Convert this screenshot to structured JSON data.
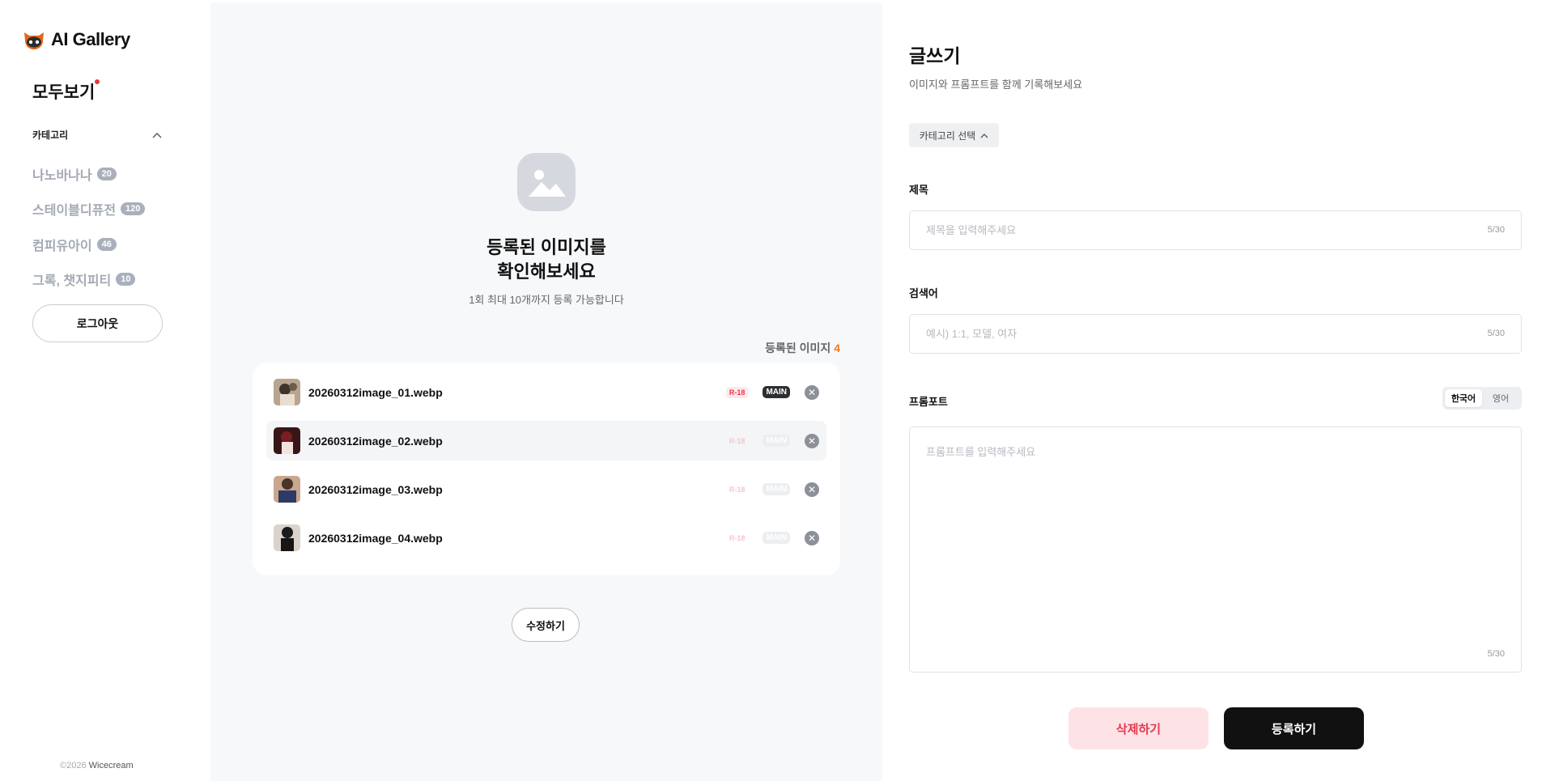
{
  "app": {
    "logo_text": "AI Gallery",
    "logo_icon": "owl-logo-icon",
    "accent": "#f07a1a"
  },
  "sidebar": {
    "all_view": "모두보기",
    "category_header": "카테고리",
    "categories": [
      {
        "label": "나노바나나",
        "count": "20"
      },
      {
        "label": "스테이블디퓨전",
        "count": "120"
      },
      {
        "label": "컴피유아이",
        "count": "46"
      },
      {
        "label": "그록, 챗지피티",
        "count": "10"
      }
    ],
    "logout_label": "로그아웃",
    "copyright_prefix": "©2026",
    "copyright_brand": "Wicecream"
  },
  "upload": {
    "title_line1": "등록된 이미지를",
    "title_line2": "확인해보세요",
    "subtitle": "1회 최대 10개까지 등록 가능합니다",
    "registered_label": "등록된 이미지",
    "registered_count": "4",
    "files": [
      {
        "name": "20260312image_01.webp",
        "r18": "R-18",
        "main": "MAIN",
        "r18_active": true,
        "main_active": true
      },
      {
        "name": "20260312image_02.webp",
        "r18": "R-18",
        "main": "MAIN",
        "r18_active": false,
        "main_active": false
      },
      {
        "name": "20260312image_03.webp",
        "r18": "R-18",
        "main": "MAIN",
        "r18_active": false,
        "main_active": false
      },
      {
        "name": "20260312image_04.webp",
        "r18": "R-18",
        "main": "MAIN",
        "r18_active": false,
        "main_active": false
      }
    ],
    "edit_label": "수정하기"
  },
  "form": {
    "title": "글쓰기",
    "subtitle": "이미지와 프롬프트를 함께 기록해보세요",
    "category_select": "카테고리 선택",
    "title_label": "제목",
    "title_placeholder": "제목을 입력해주세요",
    "title_counter": "5/30",
    "keyword_label": "검색어",
    "keyword_placeholder": "예시) 1:1, 모델, 여자",
    "keyword_counter": "5/30",
    "prompt_label": "프롬포트",
    "lang_ko": "한국어",
    "lang_en": "영어",
    "prompt_placeholder": "프롬프트를 입력해주세요",
    "prompt_counter": "5/30",
    "delete_label": "삭제하기",
    "submit_label": "등록하기"
  }
}
